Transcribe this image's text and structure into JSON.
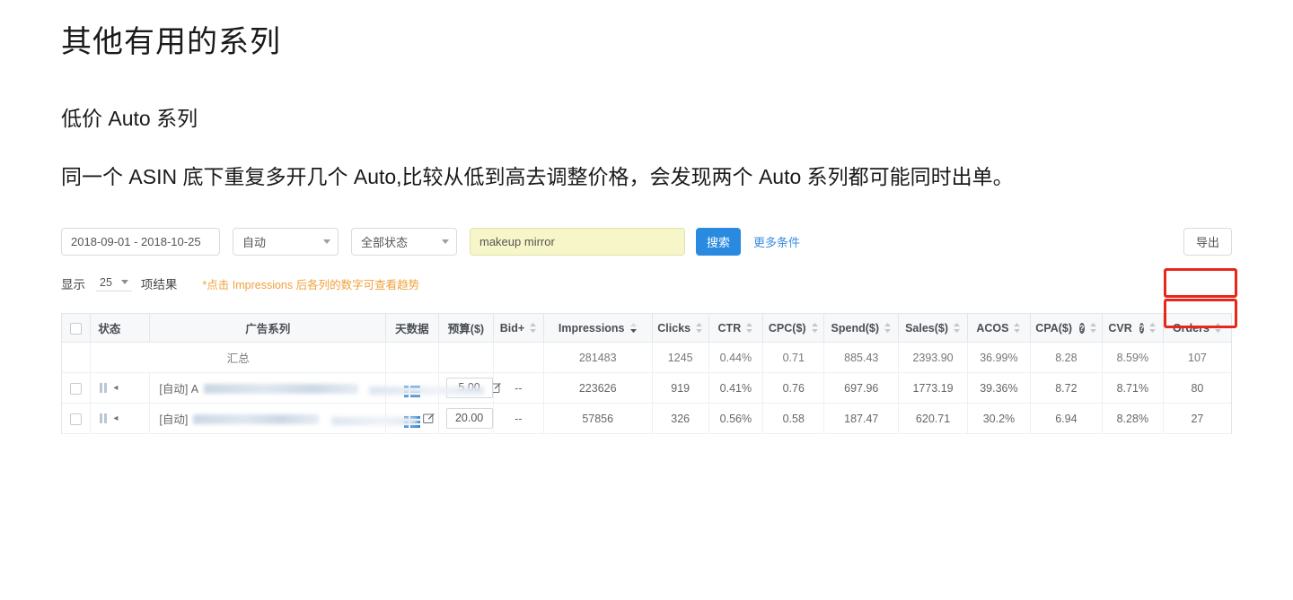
{
  "article": {
    "title": "其他有用的系列",
    "subhead": "低价 Auto 系列",
    "paragraph": "同一个 ASIN 底下重复多开几个 Auto,比较从低到高去调整价格，会发现两个 Auto 系列都可能同时出单。"
  },
  "toolbar": {
    "date_range": "2018-09-01 - 2018-10-25",
    "type_select": "自动",
    "status_select": "全部状态",
    "search_value": "makeup mirror",
    "search_placeholder": "makeup mirror",
    "search_button": "搜索",
    "more_conditions": "更多条件",
    "export_button": "导出"
  },
  "showrow": {
    "label": "显示",
    "page_size": "25",
    "suffix": "项结果",
    "hint": "*点击 Impressions 后各列的数字可查看趋势"
  },
  "table": {
    "columns": [
      {
        "key": "check",
        "label": "",
        "sort": "none",
        "help": false
      },
      {
        "key": "status",
        "label": "状态",
        "sort": "none",
        "help": false
      },
      {
        "key": "campaign",
        "label": "广告系列",
        "sort": "none",
        "help": false
      },
      {
        "key": "daydata",
        "label": "天数据",
        "sort": "none",
        "help": false
      },
      {
        "key": "budget",
        "label": "预算($)",
        "sort": "none",
        "help": false
      },
      {
        "key": "bidplus",
        "label": "Bid+",
        "sort": "both",
        "help": false
      },
      {
        "key": "impressions",
        "label": "Impressions",
        "sort": "desc",
        "help": false
      },
      {
        "key": "clicks",
        "label": "Clicks",
        "sort": "both",
        "help": false
      },
      {
        "key": "ctr",
        "label": "CTR",
        "sort": "both",
        "help": false
      },
      {
        "key": "cpc",
        "label": "CPC($)",
        "sort": "both",
        "help": false
      },
      {
        "key": "spend",
        "label": "Spend($)",
        "sort": "both",
        "help": false
      },
      {
        "key": "sales",
        "label": "Sales($)",
        "sort": "both",
        "help": false
      },
      {
        "key": "acos",
        "label": "ACOS",
        "sort": "both",
        "help": false
      },
      {
        "key": "cpa",
        "label": "CPA($)",
        "sort": "both",
        "help": true
      },
      {
        "key": "cvr",
        "label": "CVR",
        "sort": "both",
        "help": true
      },
      {
        "key": "orders",
        "label": "Orders",
        "sort": "both",
        "help": false
      }
    ],
    "summary": {
      "label": "汇总",
      "budget": "",
      "bidplus": "",
      "impressions": "281483",
      "clicks": "1245",
      "ctr": "0.44%",
      "cpc": "0.71",
      "spend": "885.43",
      "sales": "2393.90",
      "acos": "36.99%",
      "cpa": "8.28",
      "cvr": "8.59%",
      "orders": "107"
    },
    "rows": [
      {
        "campaign_prefix": "[自动] A",
        "budget": "5.00",
        "bidplus": "--",
        "impressions": "223626",
        "clicks": "919",
        "ctr": "0.41%",
        "cpc": "0.76",
        "spend": "697.96",
        "sales": "1773.19",
        "acos": "39.36%",
        "cpa": "8.72",
        "cvr": "8.71%",
        "orders": "80",
        "orders_highlighted": true
      },
      {
        "campaign_prefix": "[自动]",
        "budget": "20.00",
        "bidplus": "--",
        "impressions": "57856",
        "clicks": "326",
        "ctr": "0.56%",
        "cpc": "0.58",
        "spend": "187.47",
        "sales": "620.71",
        "acos": "30.2%",
        "cpa": "6.94",
        "cvr": "8.28%",
        "orders": "27",
        "orders_highlighted": true
      }
    ]
  },
  "icons": {
    "pause": "pause-icon",
    "sort": "sort-updown-icon",
    "edit": "edit-pencil-icon",
    "daydata": "day-data-list-icon",
    "help": "help-circle-icon",
    "caret": "chevron-down-icon"
  },
  "colors": {
    "accent_blue": "#2a8ae0",
    "link_blue": "#3c8dde",
    "hint_orange": "#f0a13c",
    "highlight_red": "#e8271a",
    "search_yellow": "#f7f6c8",
    "header_grey": "#f7f8f9"
  }
}
